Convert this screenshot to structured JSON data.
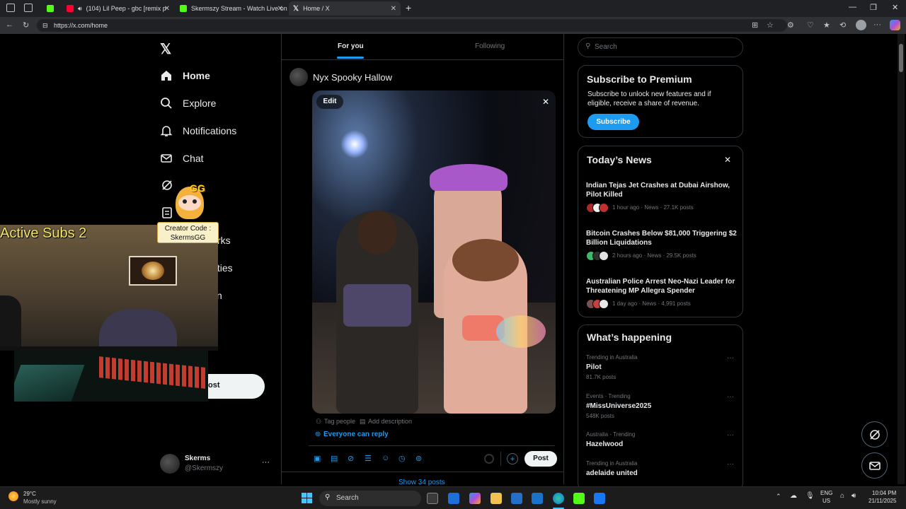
{
  "browser": {
    "tabs": [
      {
        "title": "",
        "favicon_color": "#53fc18"
      },
      {
        "title": "(104) Lil Peep - gbc [remix p",
        "favicon_color": "#ff0033"
      },
      {
        "title": "Skermszy Stream - Watch Live on",
        "favicon_color": "#53fc18"
      },
      {
        "title": "Home / X",
        "favicon_color": "#ffffff"
      }
    ],
    "url": "https://x.com/home",
    "new_tab": "+",
    "close_glyph": "✕"
  },
  "nav": {
    "logo": "𝕏",
    "items": [
      {
        "label": "Home",
        "icon": "home-icon"
      },
      {
        "label": "Explore",
        "icon": "search-icon"
      },
      {
        "label": "Notifications",
        "icon": "bell-icon"
      },
      {
        "label": "Chat",
        "icon": "mail-icon"
      }
    ],
    "partial_items": [
      "rks",
      "nities",
      "n"
    ],
    "post_button_partial": "ost",
    "account": {
      "name": "Skerms",
      "handle": "@Skermszy",
      "more": "···"
    }
  },
  "overlay": {
    "active_subs": "Active Subs 2",
    "creator_code_line1": "Creator Code :",
    "creator_code_line2": "SkermsGG",
    "gg": "GG"
  },
  "feed": {
    "tabs": [
      {
        "label": "For you",
        "active": true
      },
      {
        "label": "Following",
        "active": false
      }
    ],
    "composer": {
      "text": "Nyx Spooky Hallow",
      "edit_label": "Edit",
      "tag_people": "Tag people",
      "add_description": "Add description",
      "reply_setting": "Everyone can reply",
      "post_label": "Post"
    },
    "show_posts": "Show 34 posts"
  },
  "right": {
    "search_placeholder": "Search",
    "premium": {
      "title": "Subscribe to Premium",
      "body": "Subscribe to unlock new features and if eligible, receive a share of revenue.",
      "button": "Subscribe"
    },
    "news": {
      "title": "Today’s News",
      "items": [
        {
          "title": "Indian Tejas Jet Crashes at Dubai Airshow, Pilot Killed",
          "meta": "1 hour ago · News · 27.1K posts"
        },
        {
          "title": "Bitcoin Crashes Below $81,000 Triggering $2 Billion Liquidations",
          "meta": "2 hours ago · News · 29.5K posts"
        },
        {
          "title": "Australian Police Arrest Neo-Nazi Leader for Threatening MP Allegra Spender",
          "meta": "1 day ago · News · 4,991 posts"
        }
      ]
    },
    "happening": {
      "title": "What’s happening",
      "items": [
        {
          "category": "Trending in Australia",
          "name": "Pilot",
          "count": "81.7K posts"
        },
        {
          "category": "Events · Trending",
          "name": "#MissUniverse2025",
          "count": "548K posts"
        },
        {
          "category": "Australia · Trending",
          "name": "Hazelwood",
          "count": ""
        },
        {
          "category": "Trending in Australia",
          "name": "adelaide united",
          "count": ""
        }
      ],
      "more": "···"
    }
  },
  "taskbar": {
    "weather_temp": "29°C",
    "weather_desc": "Mostly sunny",
    "search": "Search",
    "lang_top": "ENG",
    "lang_bottom": "US",
    "time": "10:04 PM",
    "date": "21/11/2025"
  },
  "colors": {
    "accent": "#1d9bf0",
    "border": "#2f3336",
    "muted": "#71767b"
  }
}
